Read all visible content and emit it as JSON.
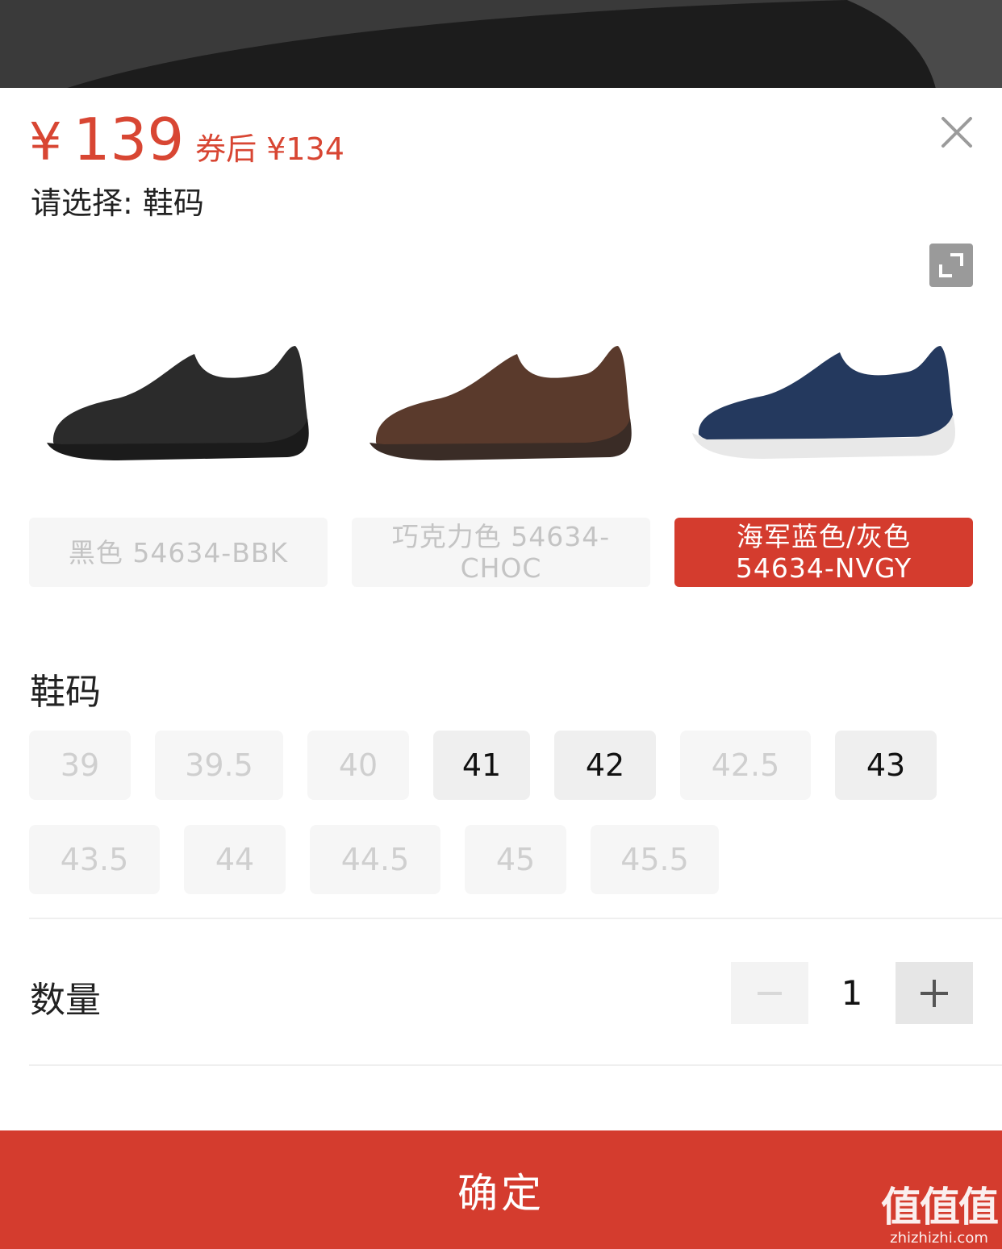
{
  "price": {
    "currency_symbol": "¥",
    "amount": "139",
    "coupon_text": "券后 ¥134",
    "color": "#d84633"
  },
  "select_hint": "请选择: 鞋码",
  "icons": {
    "close": "close-icon",
    "expand": "expand-icon",
    "minus": "minus-icon",
    "plus": "plus-icon"
  },
  "variants": [
    {
      "label": "黑色 54634-BBK",
      "selected": false,
      "image": "black-shoe"
    },
    {
      "label": "巧克力色 54634-CHOC",
      "selected": false,
      "image": "chocolate-shoe"
    },
    {
      "label": "海军蓝色/灰色 54634-NVGY",
      "selected": true,
      "image": "navy-gray-shoe"
    }
  ],
  "size_section": {
    "title": "鞋码",
    "sizes": [
      {
        "label": "39",
        "available": false
      },
      {
        "label": "39.5",
        "available": false
      },
      {
        "label": "40",
        "available": false
      },
      {
        "label": "41",
        "available": true
      },
      {
        "label": "42",
        "available": true
      },
      {
        "label": "42.5",
        "available": false
      },
      {
        "label": "43",
        "available": true
      },
      {
        "label": "43.5",
        "available": false
      },
      {
        "label": "44",
        "available": false
      },
      {
        "label": "44.5",
        "available": false
      },
      {
        "label": "45",
        "available": false
      },
      {
        "label": "45.5",
        "available": false
      }
    ]
  },
  "quantity": {
    "title": "数量",
    "value": "1"
  },
  "confirm_label": "确定",
  "watermark": {
    "text": "值值值",
    "url": "zhizhizhi.com"
  },
  "colors": {
    "accent": "#d43c2e",
    "chip_bg": "#f6f6f6",
    "chip_disabled_text": "#cfcfcf"
  }
}
